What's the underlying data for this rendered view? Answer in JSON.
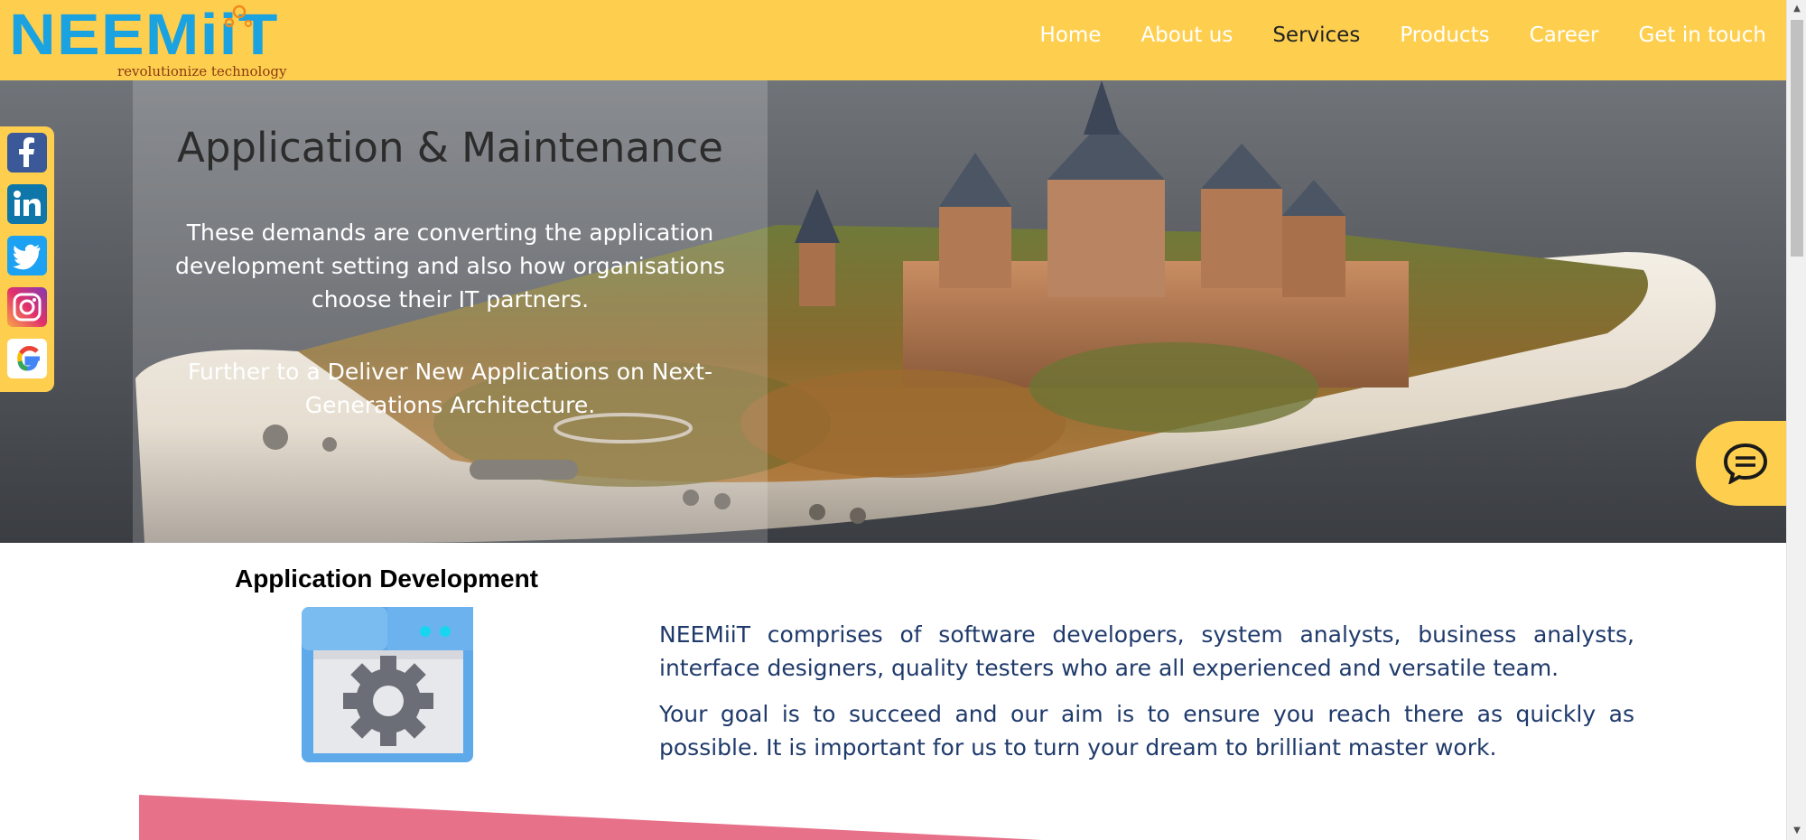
{
  "header": {
    "logo": {
      "text": "NEEMiiT",
      "tagline": "revolutionize technology"
    },
    "nav": [
      {
        "label": "Home",
        "active": false
      },
      {
        "label": "About us",
        "active": false
      },
      {
        "label": "Services",
        "active": true
      },
      {
        "label": "Products",
        "active": false
      },
      {
        "label": "Career",
        "active": false
      },
      {
        "label": "Get in touch",
        "active": false
      }
    ]
  },
  "hero": {
    "title": "Application & Maintenance",
    "paragraph1": "These demands are converting the application development setting and also how organisations choose their IT partners.",
    "paragraph2": "Further to a Deliver New Applications on Next-Generations Architecture."
  },
  "social": [
    {
      "icon": "facebook-icon",
      "color": "#3b5998"
    },
    {
      "icon": "linkedin-icon",
      "color": "#0e76a8"
    },
    {
      "icon": "twitter-icon",
      "color": "#1da1f2"
    },
    {
      "icon": "instagram-icon",
      "color": "#c13584"
    },
    {
      "icon": "google-icon",
      "color": "#ffffff"
    }
  ],
  "chat": {
    "icon": "chat-icon"
  },
  "content": {
    "heading": "Application Development",
    "paragraph1": "NEEMiiT comprises of software developers, system analysts, business analysts, interface designers, quality testers who are all experienced and versatile team.",
    "paragraph2": "Your goal is to succeed and our aim is to ensure you reach there as quickly as possible. It is important for us to turn your dream to brilliant master work."
  },
  "colors": {
    "header_bg": "#fecf4f",
    "logo_blue": "#1aa3e0",
    "text_blue": "#1f3a6b",
    "accent_pink": "#e8718a"
  }
}
